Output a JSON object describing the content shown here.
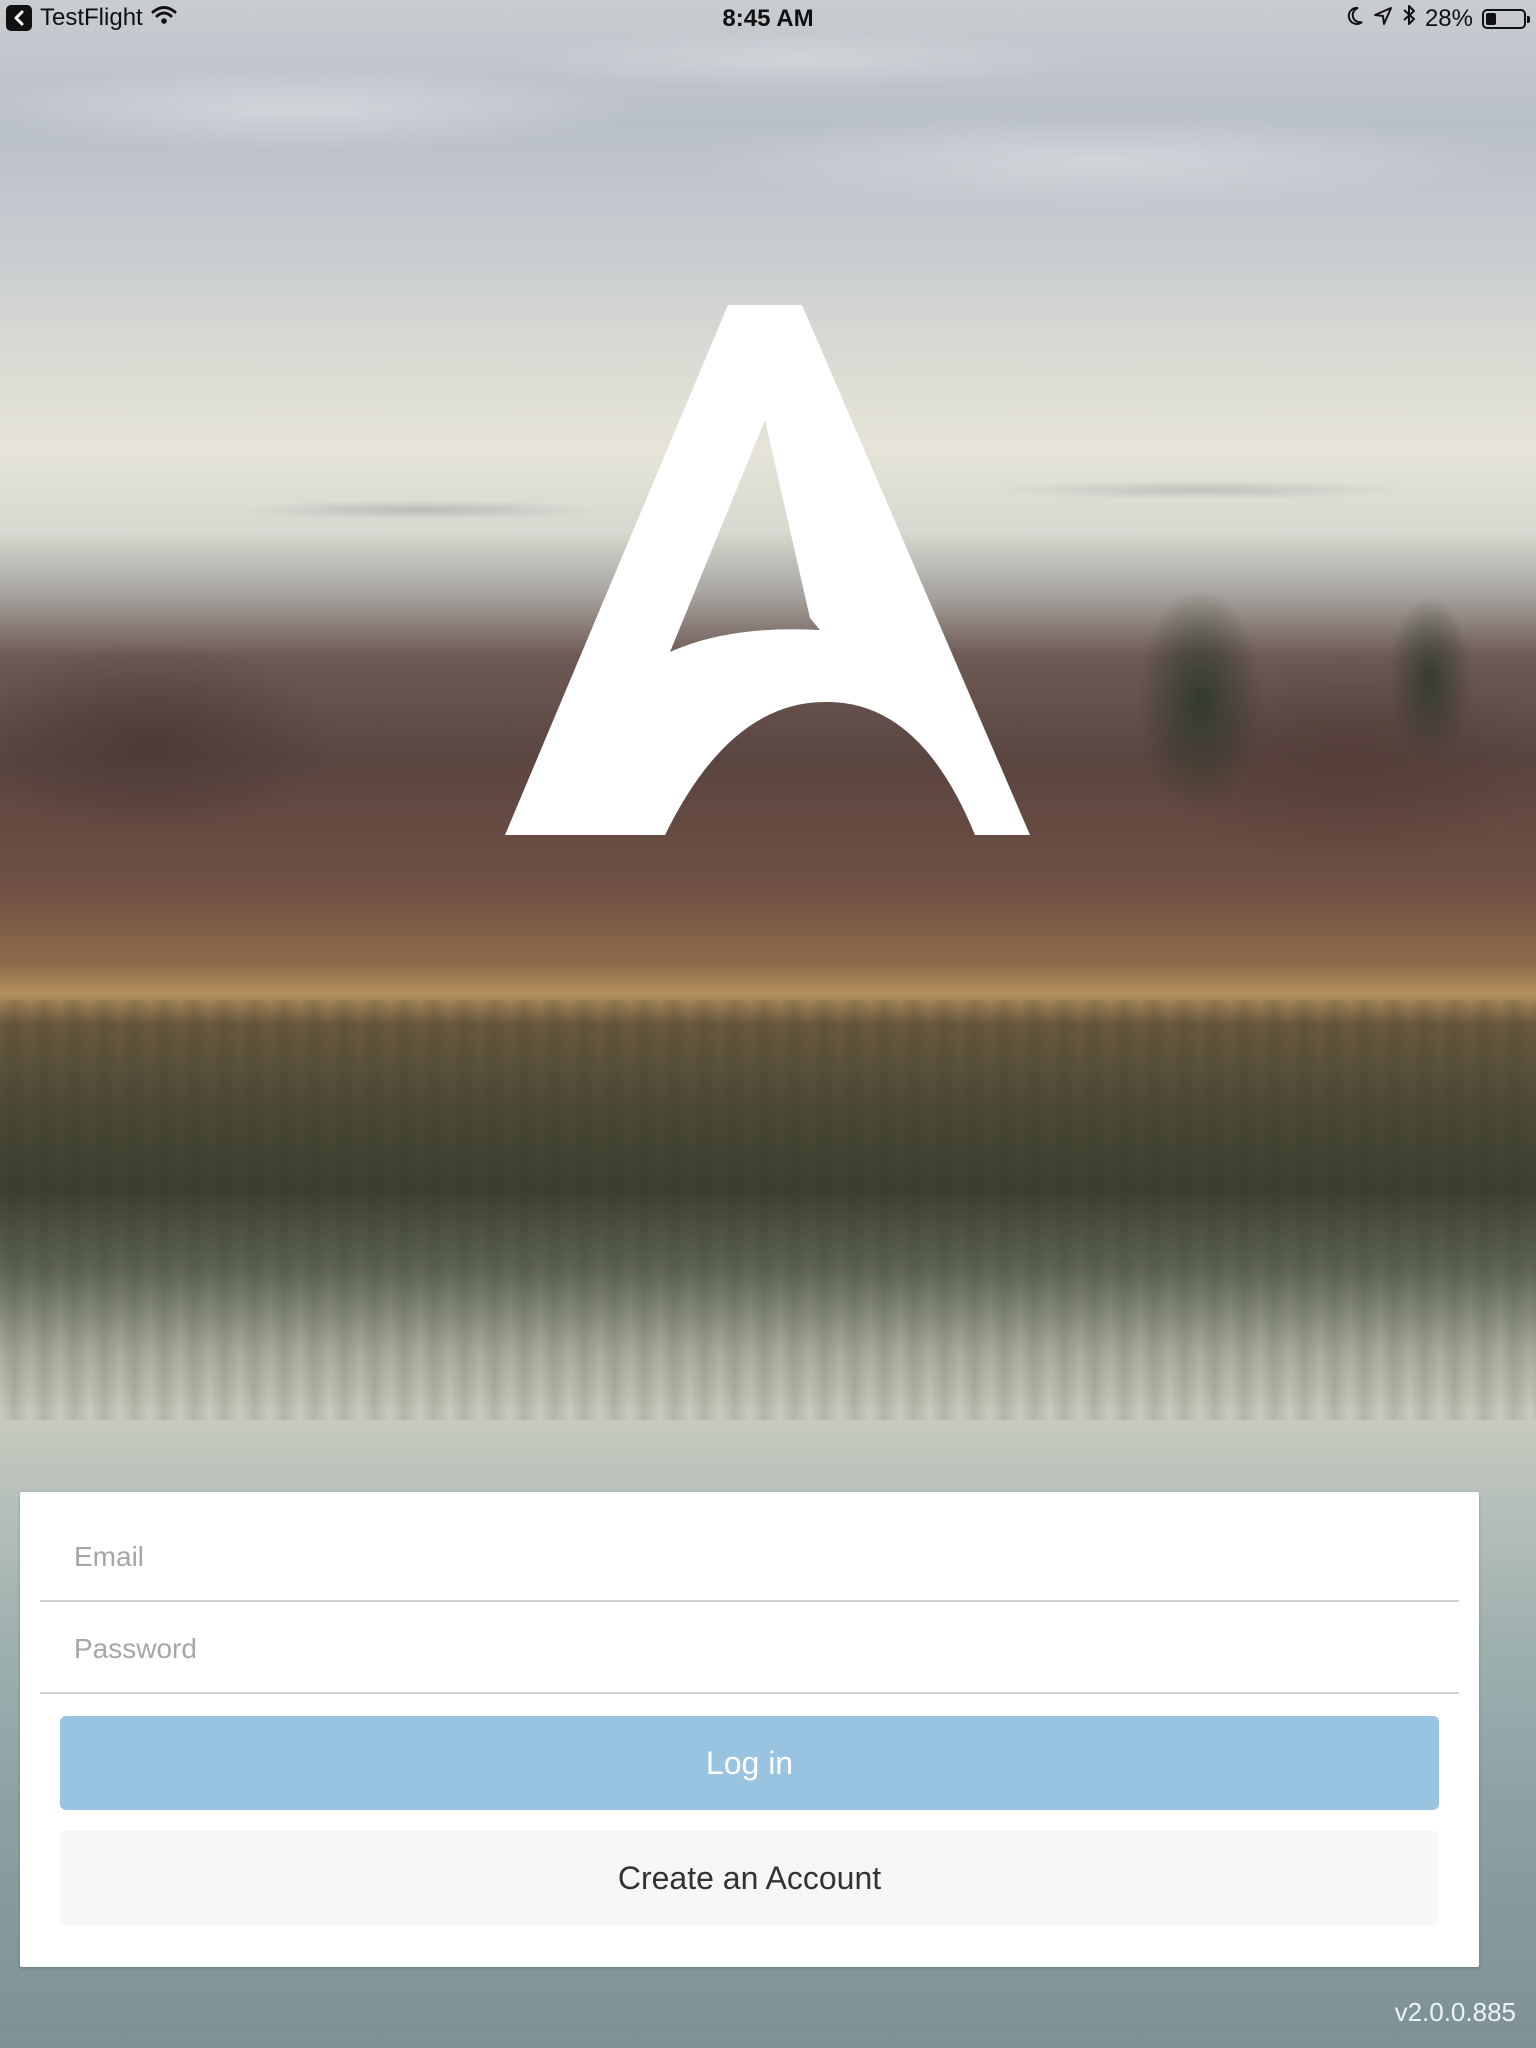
{
  "status_bar": {
    "back_app": "TestFlight",
    "time": "8:45 AM",
    "battery_percent": "28%",
    "battery_level": 0.28,
    "icons": [
      "back-chevron-icon",
      "wifi-icon",
      "moon-icon",
      "location-arrow-icon",
      "bluetooth-icon",
      "battery-icon"
    ]
  },
  "logo": {
    "icon": "app-logo-a-icon"
  },
  "login": {
    "email_placeholder": "Email",
    "password_placeholder": "Password",
    "login_label": "Log in",
    "create_account_label": "Create an Account"
  },
  "version": "v2.0.0.885",
  "colors": {
    "login_button": "#98c4e1",
    "create_button": "#f7f7f7",
    "card": "#ffffff"
  }
}
